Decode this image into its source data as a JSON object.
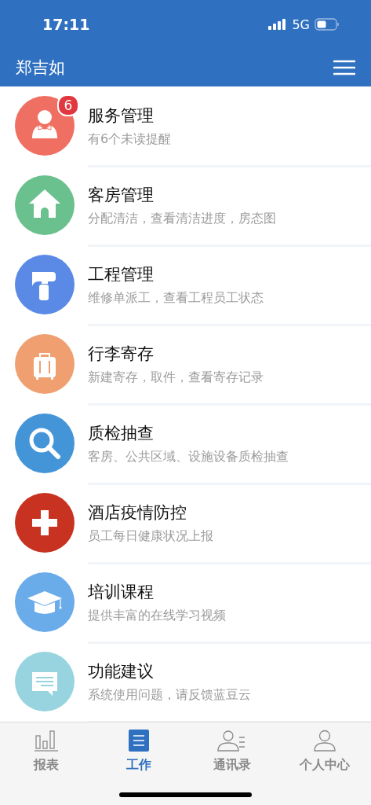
{
  "status_bar": {
    "time": "17:11",
    "network": "5G"
  },
  "header": {
    "title": "郑吉如"
  },
  "items": [
    {
      "kind": "service",
      "color": "#ef7062",
      "title": "服务管理",
      "subtitle": "有6个未读提醒",
      "badge": "6"
    },
    {
      "kind": "house",
      "color": "#6ac18e",
      "title": "客房管理",
      "subtitle": "分配清洁，查看清洁进度，房态图"
    },
    {
      "kind": "hammer",
      "color": "#5b8ae6",
      "title": "工程管理",
      "subtitle": "维修单派工，查看工程员工状态"
    },
    {
      "kind": "luggage",
      "color": "#f0a070",
      "title": "行李寄存",
      "subtitle": "新建寄存，取件，查看寄存记录"
    },
    {
      "kind": "search",
      "color": "#4495d8",
      "title": "质检抽查",
      "subtitle": "客房、公共区域、设施设备质检抽查"
    },
    {
      "kind": "cross",
      "color": "#c83221",
      "title": "酒店疫情防控",
      "subtitle": "员工每日健康状况上报"
    },
    {
      "kind": "graduation",
      "color": "#6aabea",
      "title": "培训课程",
      "subtitle": "提供丰富的在线学习视频"
    },
    {
      "kind": "chat",
      "color": "#97d4df",
      "title": "功能建议",
      "subtitle": "系统使用问题，请反馈蓝豆云"
    }
  ],
  "tabs": [
    {
      "kind": "chart",
      "label": "报表",
      "selected": false
    },
    {
      "kind": "list",
      "label": "工作",
      "selected": true
    },
    {
      "kind": "contacts",
      "label": "通讯录",
      "selected": false
    },
    {
      "kind": "person",
      "label": "个人中心",
      "selected": false
    }
  ]
}
